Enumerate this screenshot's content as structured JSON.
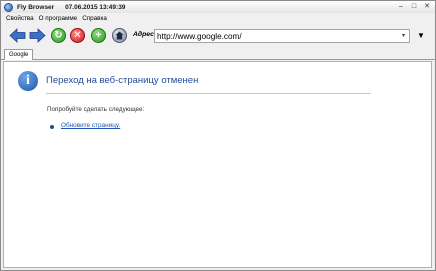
{
  "window": {
    "app_name": "Fly Browser",
    "datetime": "07.06.2015 13:49:39"
  },
  "menu": {
    "items": [
      "Свойства",
      "О программе",
      "Справка"
    ]
  },
  "toolbar": {
    "back_icon": "arrow-left",
    "forward_icon": "arrow-right",
    "refresh_icon": "refresh-green",
    "stop_icon": "stop-red",
    "add_icon": "plus-green",
    "home_icon": "home",
    "address_label": "Адрес",
    "address_value": "http://www.google.com/"
  },
  "tabs": [
    {
      "label": "Google"
    }
  ],
  "page": {
    "heading": "Переход на веб-страницу отменен",
    "subtext": "Попробуйте сделать следующее:",
    "link": "Обновите страницу."
  },
  "colors": {
    "heading": "#1f4d99",
    "link": "#1e56b5",
    "info_icon": "#1d56a8"
  }
}
